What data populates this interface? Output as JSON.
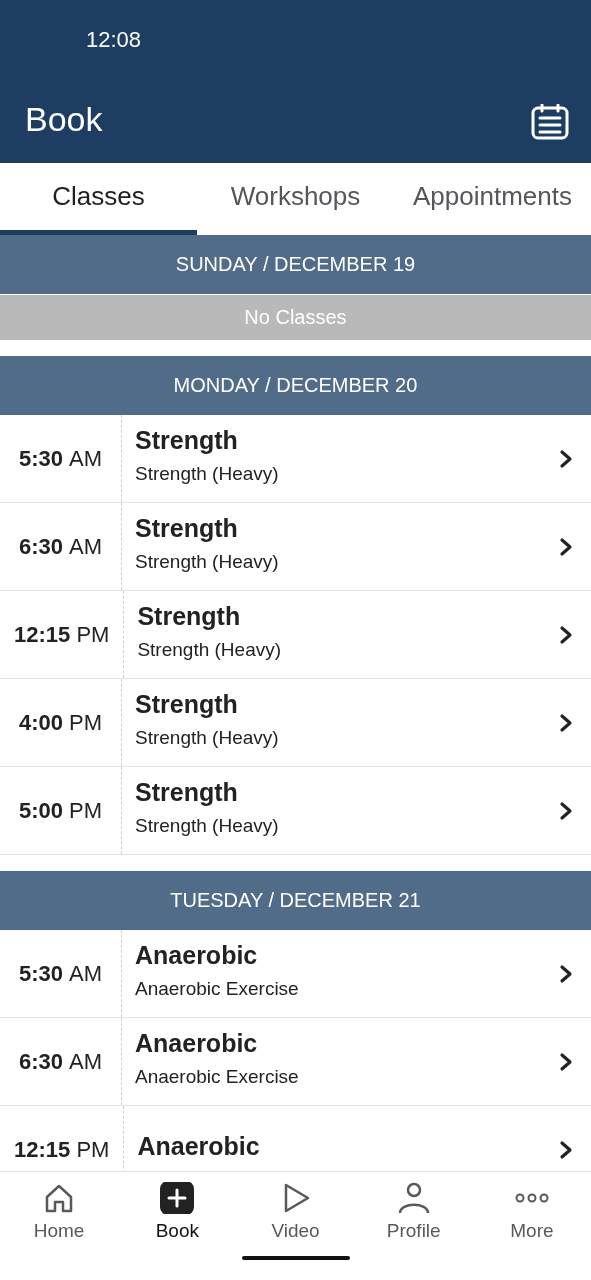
{
  "status_bar": {
    "time": "12:08"
  },
  "header": {
    "title": "Book"
  },
  "tabs": [
    {
      "label": "Classes",
      "selected": true
    },
    {
      "label": "Workshops",
      "selected": false
    },
    {
      "label": "Appointments",
      "selected": false
    }
  ],
  "days": [
    {
      "heading": "SUNDAY / DECEMBER 19",
      "empty_text": "No Classes"
    },
    {
      "heading": "MONDAY / DECEMBER 20",
      "classes": [
        {
          "time": "5:30",
          "period": "AM",
          "name": "Strength",
          "subtitle": "Strength (Heavy)"
        },
        {
          "time": "6:30",
          "period": "AM",
          "name": "Strength",
          "subtitle": "Strength (Heavy)"
        },
        {
          "time": "12:15",
          "period": "PM",
          "name": "Strength",
          "subtitle": "Strength (Heavy)"
        },
        {
          "time": "4:00",
          "period": "PM",
          "name": "Strength",
          "subtitle": "Strength (Heavy)"
        },
        {
          "time": "5:00",
          "period": "PM",
          "name": "Strength",
          "subtitle": "Strength (Heavy)"
        }
      ]
    },
    {
      "heading": "TUESDAY / DECEMBER 21",
      "classes": [
        {
          "time": "5:30",
          "period": "AM",
          "name": "Anaerobic",
          "subtitle": "Anaerobic Exercise"
        },
        {
          "time": "6:30",
          "period": "AM",
          "name": "Anaerobic",
          "subtitle": "Anaerobic Exercise"
        },
        {
          "time": "12:15",
          "period": "PM",
          "name": "Anaerobic"
        }
      ]
    }
  ],
  "nav": [
    {
      "kind": "home",
      "label": "Home",
      "selected": false
    },
    {
      "kind": "book",
      "label": "Book",
      "selected": true
    },
    {
      "kind": "video",
      "label": "Video",
      "selected": false
    },
    {
      "kind": "profile",
      "label": "Profile",
      "selected": false
    },
    {
      "kind": "more",
      "label": "More",
      "selected": false
    }
  ]
}
